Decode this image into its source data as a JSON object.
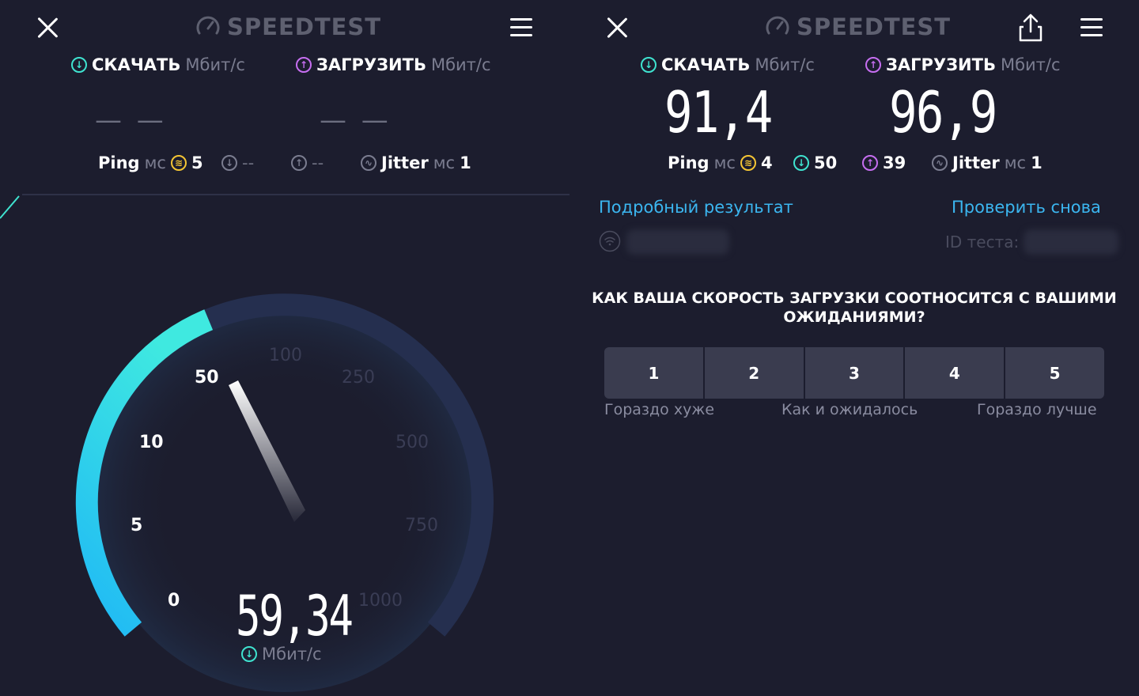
{
  "left": {
    "logo": "SPEEDTEST",
    "download_label": "СКАЧАТЬ",
    "upload_label": "ЗАГРУЗИТЬ",
    "unit_speed": "Мбит/с",
    "download_value": "— —",
    "upload_value": "— —",
    "ping_label": "Ping",
    "unit_ms": "мс",
    "ping_value": "5",
    "ping_down": "--",
    "ping_up": "--",
    "jitter_label": "Jitter",
    "jitter_value": "1",
    "gauge_ticks": [
      "0",
      "5",
      "10",
      "50",
      "100",
      "250",
      "500",
      "750",
      "1000"
    ],
    "current_speed": "59,34",
    "current_unit": "Мбит/с",
    "gauge_value_mbps": 59.34
  },
  "right": {
    "logo": "SPEEDTEST",
    "download_label": "СКАЧАТЬ",
    "upload_label": "ЗАГРУЗИТЬ",
    "unit_speed": "Мбит/с",
    "download_value": "91,4",
    "upload_value": "96,9",
    "ping_label": "Ping",
    "unit_ms": "мс",
    "ping_value": "4",
    "ping_down": "50",
    "ping_up": "39",
    "jitter_label": "Jitter",
    "jitter_value": "1",
    "detailed_link": "Подробный результат",
    "retest_link": "Проверить снова",
    "test_id_label": "ID теста:",
    "question": "КАК ВАША СКОРОСТЬ ЗАГРУЗКИ СООТНОСИТСЯ С ВАШИМИ ОЖИДАНИЯМИ?",
    "ratings": [
      "1",
      "2",
      "3",
      "4",
      "5"
    ],
    "scale_low": "Гораздо хуже",
    "scale_mid": "Как и ожидалось",
    "scale_high": "Гораздо лучше"
  },
  "colors": {
    "background": "#1c1d2e",
    "download": "#3fe3d0",
    "upload": "#c66ef0",
    "ping": "#f4c534",
    "link": "#3bb6f0",
    "gauge_track": "#252f4f",
    "gauge_fill_start": "#1fb8f5",
    "gauge_fill_end": "#3fe9e0"
  }
}
